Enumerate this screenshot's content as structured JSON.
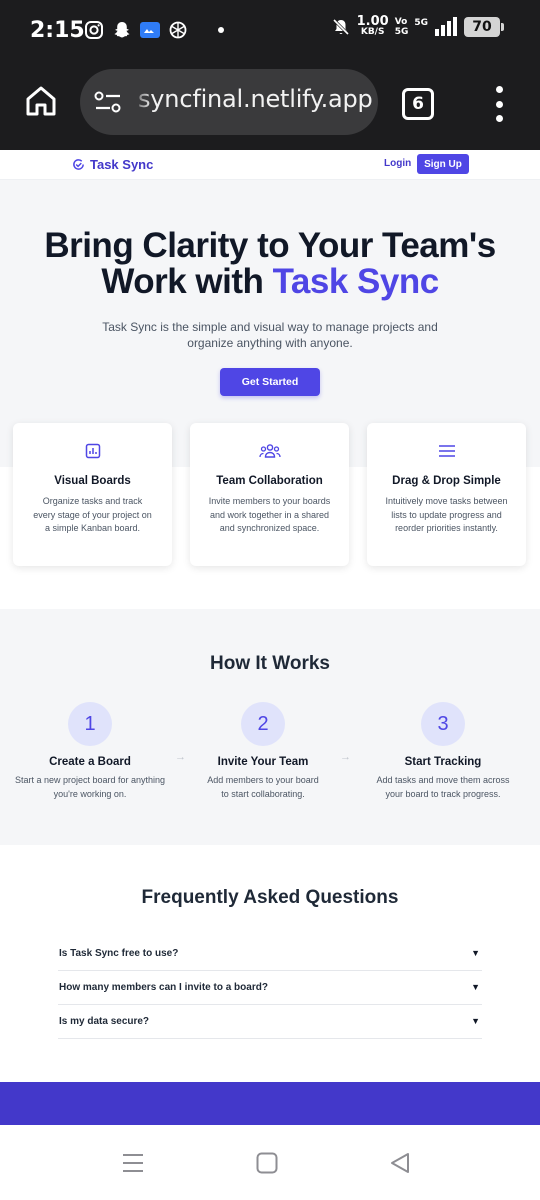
{
  "status_bar": {
    "time": "2:15",
    "net_speed_value": "1.00",
    "net_speed_unit": "KB/S",
    "volte_top": "Vo",
    "volte_bottom": "5G",
    "network": "5G",
    "battery": "70"
  },
  "browser": {
    "url": "syncfinal.netlify.app",
    "tab_count": "6"
  },
  "nav": {
    "brand": "Task Sync",
    "login": "Login",
    "signup": "Sign Up"
  },
  "hero": {
    "title_line1": "Bring Clarity to Your Team's",
    "title_line2_prefix": "Work with ",
    "title_accent": "Task Sync",
    "subtitle": "Task Sync is the simple and visual way to manage projects and organize anything with anyone.",
    "cta": "Get Started"
  },
  "features": [
    {
      "icon": "board-icon",
      "title": "Visual Boards",
      "desc": "Organize tasks and track every stage of your project on a simple Kanban board."
    },
    {
      "icon": "team-icon",
      "title": "Team Collaboration",
      "desc": "Invite members to your boards and work together in a shared and synchronized space."
    },
    {
      "icon": "menu-lines-icon",
      "title": "Drag & Drop Simple",
      "desc": "Intuitively move tasks between lists to update progress and reorder priorities instantly."
    }
  ],
  "how_it_works": {
    "title": "How It Works",
    "arrow": "→",
    "steps": [
      {
        "num": "1",
        "title": "Create a Board",
        "desc": "Start a new project board for anything you're working on."
      },
      {
        "num": "2",
        "title": "Invite Your Team",
        "desc": "Add members to your board to start collaborating."
      },
      {
        "num": "3",
        "title": "Start Tracking",
        "desc": "Add tasks and move them across your board to track progress."
      }
    ]
  },
  "faq": {
    "title": "Frequently Asked Questions",
    "caret": "▼",
    "items": [
      {
        "q": "Is Task Sync free to use?"
      },
      {
        "q": "How many members can I invite to a board?"
      },
      {
        "q": "Is my data secure?"
      }
    ]
  },
  "colors": {
    "accent": "#4f46e5",
    "accent_dark": "#4338ca",
    "section_bg": "#f5f6f8",
    "browser_chrome": "#1c1c1e"
  }
}
